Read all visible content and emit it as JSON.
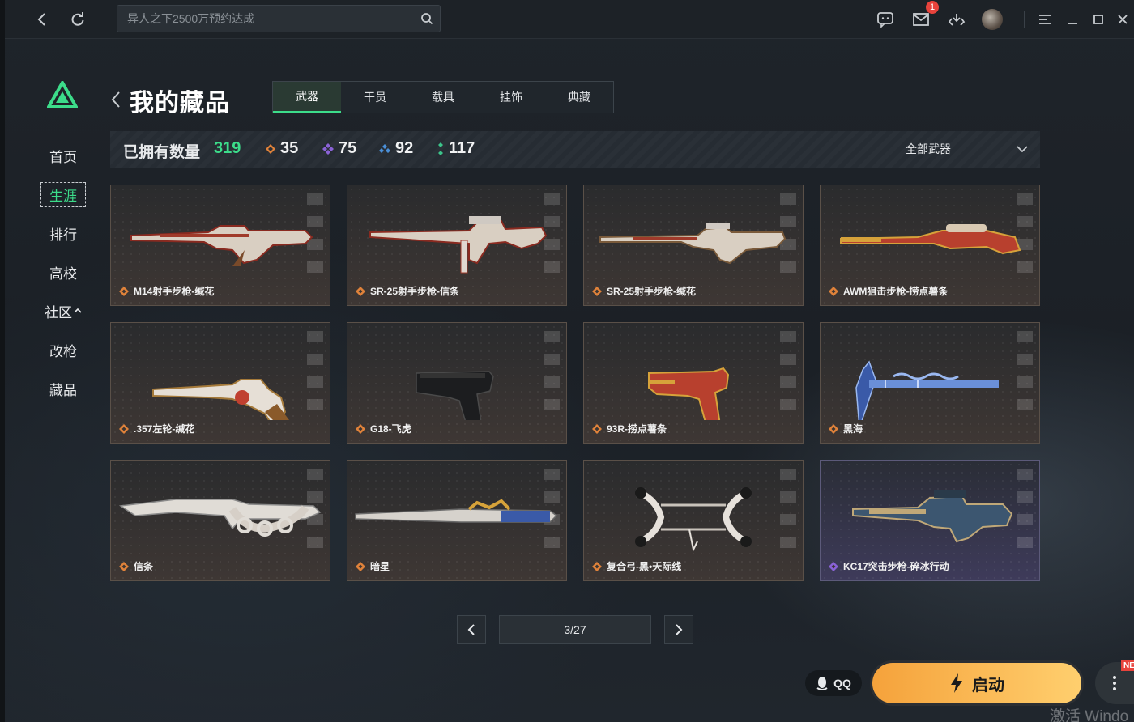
{
  "search": {
    "placeholder": "异人之下2500万预约达成"
  },
  "topbar": {
    "mail_badge": "1"
  },
  "sidebar": {
    "items": [
      {
        "label": "首页",
        "active": false
      },
      {
        "label": "生涯",
        "active": true
      },
      {
        "label": "排行",
        "active": false
      },
      {
        "label": "高校",
        "active": false
      },
      {
        "label": "社区",
        "active": false,
        "expand_icon": "chevron-up-icon"
      },
      {
        "label": "改枪",
        "active": false
      },
      {
        "label": "藏品",
        "active": false
      }
    ]
  },
  "page": {
    "title": "我的藏品"
  },
  "tabs": [
    {
      "label": "武器",
      "active": true
    },
    {
      "label": "干员",
      "active": false
    },
    {
      "label": "载具",
      "active": false
    },
    {
      "label": "挂饰",
      "active": false
    },
    {
      "label": "典藏",
      "active": false
    }
  ],
  "stats": {
    "label": "已拥有数量",
    "total": "319",
    "counts": [
      {
        "value": "35",
        "color": "#e0823a",
        "icon": "orange-diamond-icon"
      },
      {
        "value": "75",
        "color": "#8a62d6",
        "icon": "purple-diamond-icon"
      },
      {
        "value": "92",
        "color": "#4a8fd8",
        "icon": "blue-diamond-icon"
      },
      {
        "value": "117",
        "color": "#3cc48a",
        "icon": "green-diamond-icon"
      }
    ],
    "filter_label": "全部武器"
  },
  "items": [
    {
      "name": "M14射手步枪-缄花",
      "rarity": "orange",
      "kind": "rifle"
    },
    {
      "name": "SR-25射手步枪-信条",
      "rarity": "orange",
      "kind": "rifle2"
    },
    {
      "name": "SR-25射手步枪-缄花",
      "rarity": "orange",
      "kind": "rifle3"
    },
    {
      "name": "AWM狙击步枪-捞点薯条",
      "rarity": "orange",
      "kind": "sniper"
    },
    {
      "name": ".357左轮-缄花",
      "rarity": "orange",
      "kind": "revolver"
    },
    {
      "name": "G18-飞虎",
      "rarity": "orange",
      "kind": "pistol"
    },
    {
      "name": "93R-捞点薯条",
      "rarity": "orange",
      "kind": "pistol-red"
    },
    {
      "name": "黑海",
      "rarity": "orange",
      "kind": "axe"
    },
    {
      "name": "信条",
      "rarity": "orange",
      "kind": "knife"
    },
    {
      "name": "暗星",
      "rarity": "orange",
      "kind": "blade"
    },
    {
      "name": "复合弓-黑•天际线",
      "rarity": "orange",
      "kind": "bow"
    },
    {
      "name": "KC17突击步枪-碎冰行动",
      "rarity": "purple",
      "kind": "assault"
    }
  ],
  "pagination": {
    "current": "3/27"
  },
  "footer": {
    "qq_label": "QQ",
    "launch_label": "启动",
    "new_tag": "NEW",
    "watermark": "激活 Windo"
  }
}
